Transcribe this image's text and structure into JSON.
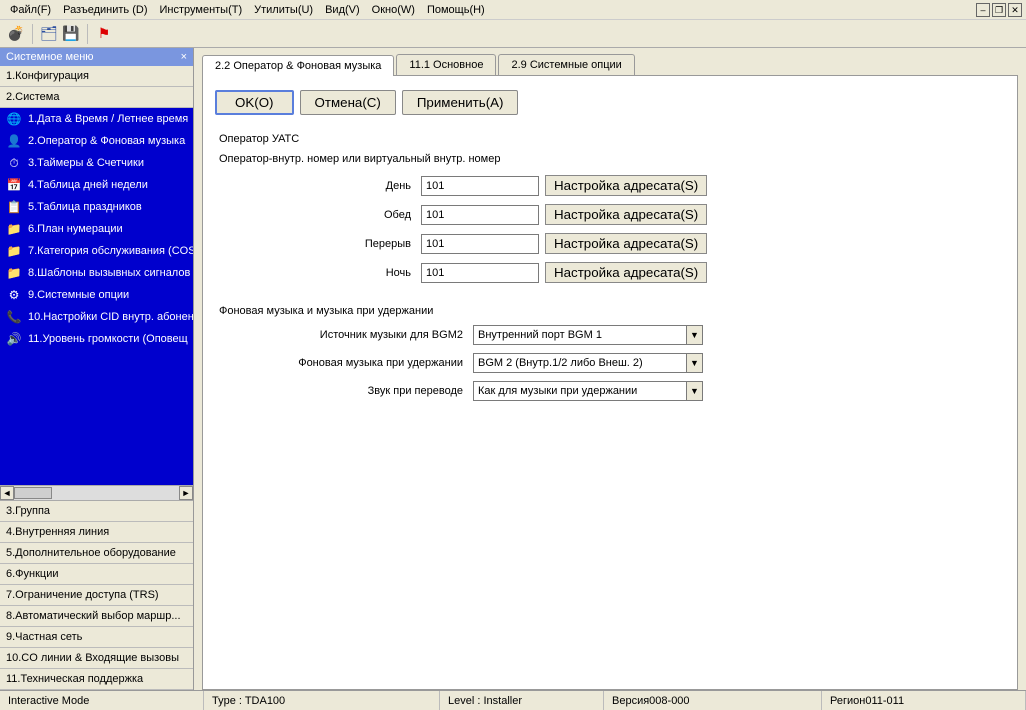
{
  "menubar": {
    "items": [
      "Файл(F)",
      "Разъединить (D)",
      "Инструменты(T)",
      "Утилиты(U)",
      "Вид(V)",
      "Окно(W)",
      "Помощь(H)"
    ]
  },
  "sidebar": {
    "title": "Системное меню",
    "nodes_top": [
      "1.Конфигурация",
      "2.Система"
    ],
    "sub_items": [
      "1.Дата & Время / Летнее время",
      "2.Оператор & Фоновая музыка",
      "3.Таймеры & Счетчики",
      "4.Таблица дней недели",
      "5.Таблица праздников",
      "6.План нумерации",
      "7.Категория обслуживания (COS",
      "8.Шаблоны вызывных сигналов",
      "9.Системные опции",
      "10.Настройки CID внутр. абонен",
      "11.Уровень громкости (Оповещ"
    ],
    "nodes_bottom": [
      "3.Группа",
      "4.Внутренняя линия",
      "5.Дополнительное оборудование",
      "6.Функции",
      "7.Ограничение доступа (TRS)",
      "8.Автоматический выбор маршр...",
      "9.Частная сеть",
      "10.CO линии & Входящие вызовы",
      "11.Техническая поддержка"
    ]
  },
  "tabs": [
    "2.2 Оператор & Фоновая музыка",
    "11.1 Основное",
    "2.9 Системные опции"
  ],
  "buttons": {
    "ok": "OK(O)",
    "cancel": "Отмена(C)",
    "apply": "Применить(A)"
  },
  "group1": {
    "title": "Оператор УАТС",
    "subtitle": "Оператор-внутр. номер или виртуальный внутр. номер",
    "rows": [
      {
        "label": "День",
        "value": "101"
      },
      {
        "label": "Обед",
        "value": "101"
      },
      {
        "label": "Перерыв",
        "value": "101"
      },
      {
        "label": "Ночь",
        "value": "101"
      }
    ],
    "dest_btn": "Настройка адресата(S)"
  },
  "group2": {
    "title": "Фоновая музыка и музыка при удержании",
    "rows": [
      {
        "label": "Источник музыки для BGM2",
        "value": "Внутренний порт BGM 1"
      },
      {
        "label": "Фоновая музыка при удержании",
        "value": "BGM 2 (Внутр.1/2 либо Внеш. 2)"
      },
      {
        "label": "Звук при переводе",
        "value": "Как для музыки при удержании"
      }
    ]
  },
  "statusbar": {
    "mode": "Interactive Mode",
    "type": "Type : TDA100",
    "level": "Level : Installer",
    "version": "Версия008-000",
    "region": "Регион011-011"
  }
}
